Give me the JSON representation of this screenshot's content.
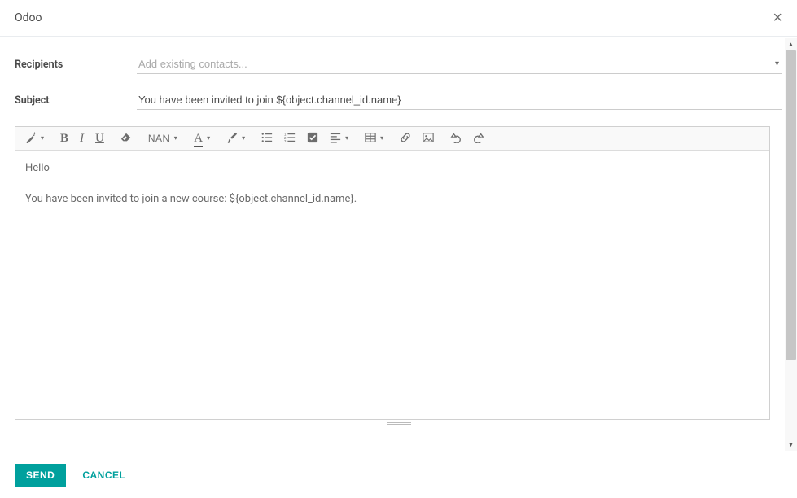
{
  "header": {
    "title": "Odoo"
  },
  "form": {
    "recipients_label": "Recipients",
    "recipients_placeholder": "Add existing contacts...",
    "recipients_value": "",
    "subject_label": "Subject",
    "subject_value": "You have been invited to join ${object.channel_id.name}"
  },
  "toolbar": {
    "font_size_label": "NAN"
  },
  "editor": {
    "line1": "Hello",
    "line2": "You have been invited to join a new course: ${object.channel_id.name}."
  },
  "footer": {
    "send_label": "SEND",
    "cancel_label": "CANCEL"
  }
}
